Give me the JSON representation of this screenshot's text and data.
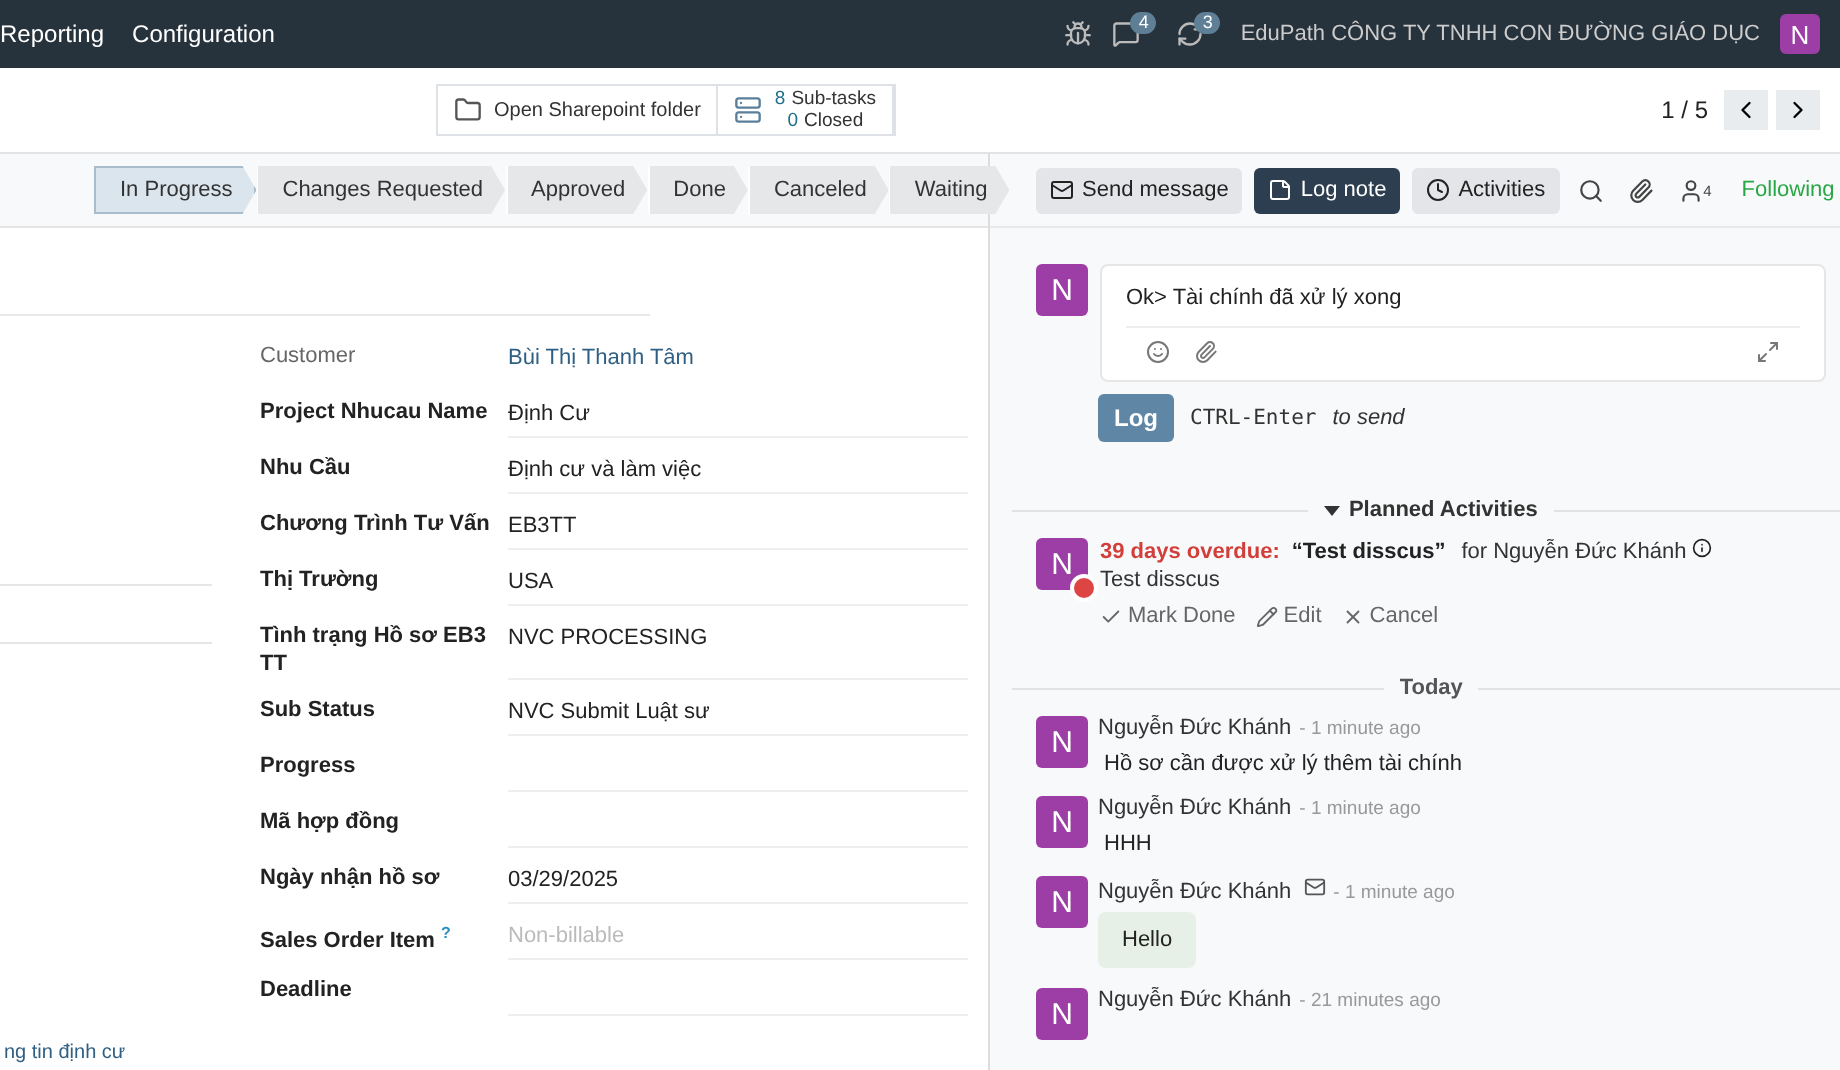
{
  "navbar": {
    "menu": [
      "Reporting",
      "Configuration"
    ],
    "message_count": "4",
    "activity_count": "3",
    "company": "EduPath  CÔNG TY TNHH CON ĐƯỜNG GIÁO DỤC",
    "user_initial": "N"
  },
  "control_panel": {
    "sharepoint_button": "Open Sharepoint folder",
    "subtasks": {
      "count": "8",
      "label": "Sub-tasks"
    },
    "closed": {
      "count": "0",
      "label": "Closed"
    },
    "pager": "1 / 5"
  },
  "stages": [
    {
      "label": "In Progress",
      "selected": true
    },
    {
      "label": "Changes Requested",
      "selected": false
    },
    {
      "label": "Approved",
      "selected": false
    },
    {
      "label": "Done",
      "selected": false
    },
    {
      "label": "Canceled",
      "selected": false
    },
    {
      "label": "Waiting",
      "selected": false
    }
  ],
  "chatter_actions": {
    "send_message": "Send message",
    "log_note": "Log note",
    "activities": "Activities",
    "followers_count": "4",
    "following": "Following"
  },
  "fields": [
    {
      "label": "Customer",
      "value": "Bùi Thị Thanh Tâm",
      "kind": "link"
    },
    {
      "label": "Project Nhucau Name",
      "value": "Định Cư",
      "kind": "text"
    },
    {
      "label": "Nhu Cầu",
      "value": "Định cư và làm việc",
      "kind": "text"
    },
    {
      "label": "Chương Trình Tư Vấn",
      "value": "EB3TT",
      "kind": "text"
    },
    {
      "label": "Thị Trường",
      "value": "USA",
      "kind": "text"
    },
    {
      "label": "Tình trạng Hồ sơ EB3 TT",
      "value": "NVC PROCESSING",
      "kind": "text"
    },
    {
      "label": "Sub Status",
      "value": "NVC Submit Luật sư",
      "kind": "text"
    },
    {
      "label": "Progress",
      "kind": "text"
    },
    {
      "label": "Mã hợp đồng",
      "kind": "text"
    },
    {
      "label": "Ngày nhận hồ sơ",
      "value": "03/29/2025",
      "kind": "text"
    },
    {
      "label": "Sales Order Item",
      "help": "?",
      "placeholder": "Non-billable",
      "kind": "text"
    },
    {
      "label": "Deadline",
      "kind": "text"
    }
  ],
  "bottom_link": "ng tin định cư",
  "composer": {
    "avatar": "N",
    "text": "Ok> Tài chính đã xử lý xong",
    "log_button": "Log",
    "hint_key": "CTRL-Enter",
    "hint_text": "to send"
  },
  "planned": {
    "title": "Planned Activities",
    "expanded": true,
    "activities": [
      {
        "avatar": "N",
        "overdue": "39 days overdue:",
        "summary": "“Test disscus”",
        "assignee": "for Nguyễn Đức Khánh",
        "note": "Test disscus",
        "actions": [
          "Mark Done",
          "Edit",
          "Cancel"
        ]
      }
    ]
  },
  "date_separator": "Today",
  "messages": [
    {
      "avatar": "N",
      "author": "Nguyễn Đức Khánh",
      "time": "- 1 minute ago",
      "body": "Hồ sơ cần được xử lý thêm tài chính",
      "kind": "note"
    },
    {
      "avatar": "N",
      "author": "Nguyễn Đức Khánh",
      "time": "- 1 minute ago",
      "body": "HHH",
      "kind": "note"
    },
    {
      "avatar": "N",
      "author": "Nguyễn Đức Khánh",
      "time": "- 1 minute ago",
      "body": "Hello",
      "kind": "email"
    },
    {
      "avatar": "N",
      "author": "Nguyễn Đức Khánh",
      "time": "- 21 minutes ago",
      "kind": "note"
    }
  ]
}
